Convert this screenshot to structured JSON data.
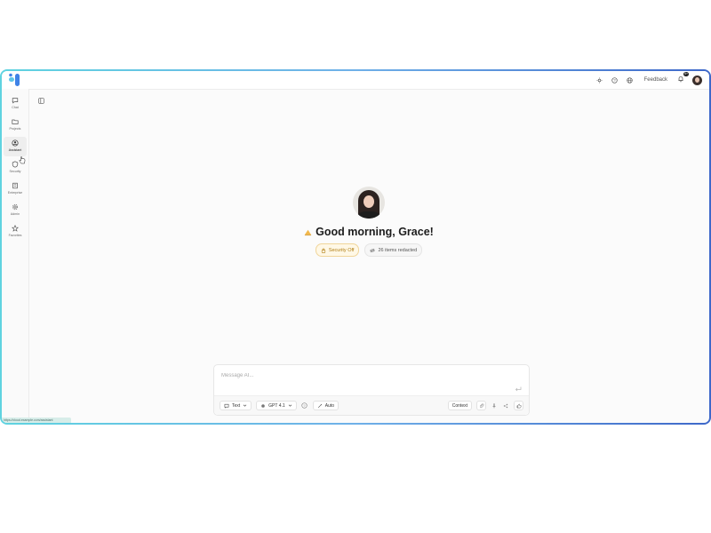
{
  "topbar": {
    "feedback_label": "Feedback",
    "notification_badge": "9+"
  },
  "sidebar": {
    "items": [
      {
        "label": "Chat",
        "icon": "chat-icon",
        "active": false
      },
      {
        "label": "Projects",
        "icon": "folder-icon",
        "active": false
      },
      {
        "label": "Assistant",
        "icon": "assistant-icon",
        "active": true
      },
      {
        "label": "Security",
        "icon": "shield-icon",
        "active": false
      },
      {
        "label": "Enterprise",
        "icon": "building-icon",
        "active": false
      },
      {
        "label": "Admin",
        "icon": "gear-icon",
        "active": false
      },
      {
        "label": "Favorites",
        "icon": "star-icon",
        "active": false
      }
    ]
  },
  "hero": {
    "greeting": "Good morning, Grace!",
    "greeting_icon": "sun-icon",
    "chips": {
      "security": "Security Off",
      "redacted": "26 items redacted"
    }
  },
  "composer": {
    "placeholder": "Message AI...",
    "mode_label": "Text",
    "model_label": "GPT 4.1",
    "auto_label": "Auto",
    "context_label": "Context"
  },
  "status_bar": {
    "url": "https://cloud.example.com/assistant"
  },
  "colors": {
    "frame_start": "#5fd3e0",
    "frame_end": "#3e68c9",
    "security_chip_text": "#b07e12"
  }
}
